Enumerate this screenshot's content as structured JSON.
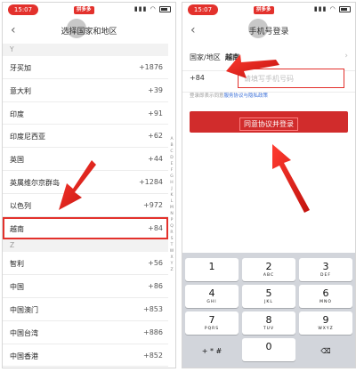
{
  "left_screen": {
    "status": {
      "time": "15:07",
      "app_badge": "拼多多"
    },
    "nav": {
      "back_glyph": "‹",
      "title": "选择国家和地区"
    },
    "sections": [
      {
        "letter": "Y",
        "rows": [
          {
            "name": "牙买加",
            "code": "+1876"
          },
          {
            "name": "意大利",
            "code": "+39"
          },
          {
            "name": "印度",
            "code": "+91"
          },
          {
            "name": "印度尼西亚",
            "code": "+62"
          },
          {
            "name": "英国",
            "code": "+44"
          },
          {
            "name": "英属维尔京群岛",
            "code": "+1284"
          },
          {
            "name": "以色列",
            "code": "+972"
          },
          {
            "name": "越南",
            "code": "+84"
          }
        ]
      },
      {
        "letter": "Z",
        "rows": [
          {
            "name": "智利",
            "code": "+56"
          },
          {
            "name": "中国",
            "code": "+86"
          },
          {
            "name": "中国澳门",
            "code": "+853"
          },
          {
            "name": "中国台湾",
            "code": "+886"
          },
          {
            "name": "中国香港",
            "code": "+852"
          }
        ]
      }
    ],
    "index_letters": [
      "A",
      "B",
      "C",
      "D",
      "E",
      "F",
      "G",
      "H",
      "J",
      "K",
      "L",
      "M",
      "N",
      "P",
      "Q",
      "R",
      "S",
      "T",
      "W",
      "X",
      "Y",
      "Z"
    ]
  },
  "right_screen": {
    "status": {
      "time": "15:07",
      "app_badge": "拼多多"
    },
    "nav": {
      "back_glyph": "‹",
      "title": "手机号登录"
    },
    "country_label": "国家/地区",
    "country_value": "越南",
    "chevron": "›",
    "dial_code": "+84",
    "phone_placeholder": "请填写手机号码",
    "agree_prefix": "登录即表示同意",
    "agree_link": "服务协议与隐私政策",
    "login_button": "同意协议并登录",
    "keypad": [
      {
        "num": "1",
        "sub": ""
      },
      {
        "num": "2",
        "sub": "ABC"
      },
      {
        "num": "3",
        "sub": "DEF"
      },
      {
        "num": "4",
        "sub": "GHI"
      },
      {
        "num": "5",
        "sub": "JKL"
      },
      {
        "num": "6",
        "sub": "MNO"
      },
      {
        "num": "7",
        "sub": "PQRS"
      },
      {
        "num": "8",
        "sub": "TUV"
      },
      {
        "num": "9",
        "sub": "WXYZ"
      },
      {
        "num": "+ * #",
        "sub": ""
      },
      {
        "num": "0",
        "sub": ""
      },
      {
        "num": "⌫",
        "sub": ""
      }
    ]
  },
  "colors": {
    "accent": "#e3312c",
    "button": "#d12c2c",
    "keypad_bg": "#d2d5db"
  }
}
